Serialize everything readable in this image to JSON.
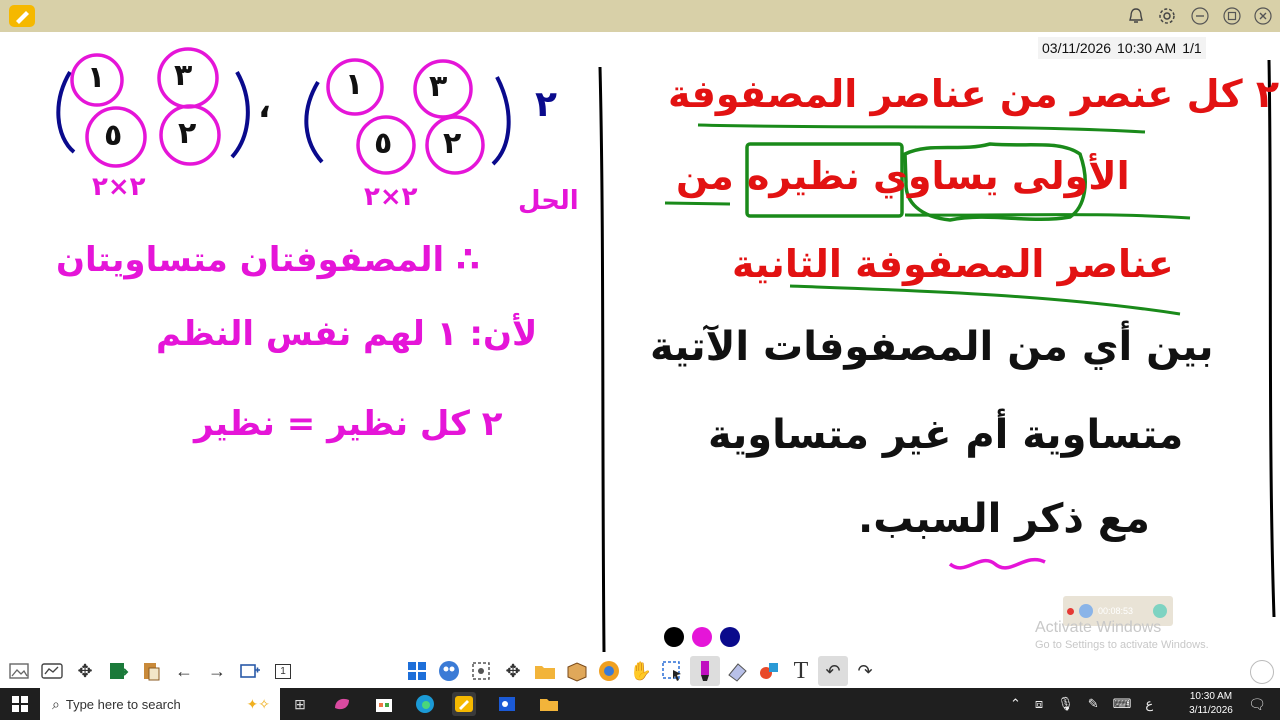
{
  "titlebar": {
    "icons": [
      "pencil-app-icon",
      "bell-icon",
      "settings-icon",
      "minimize-icon",
      "restore-icon",
      "close-icon"
    ]
  },
  "status": {
    "date": "03/11/2026",
    "time": "10:30 AM",
    "page": "1/1"
  },
  "board": {
    "left_panel": {
      "set_label": "٢",
      "matrix_a": [
        "١",
        "٣",
        "٥",
        "٢"
      ],
      "matrix_b": [
        "١",
        "٣",
        "٥",
        "٢"
      ],
      "separator": "،",
      "dims_a": "٢×٢",
      "dims_b": "٢×٢",
      "note": "الحل",
      "line1": "∴ المصفوفتان متساويتان",
      "line2": "لأن: ١ لهم نفس النظم",
      "line3": "٢ كل نظير = نظير"
    },
    "right_panel": {
      "line1": "٢ كل عنصر من عناصر المصفوفة",
      "line2": "الأولى يساوي نظيره من",
      "line3": "عناصر المصفوفة الثانية",
      "line4": "بين أي من المصفوفات الآتية",
      "line5": "متساوية أم غير متساوية",
      "line6": "مع ذكر السبب."
    }
  },
  "recorder": {
    "time": "00:08:53"
  },
  "watermark": {
    "title": "Activate Windows",
    "subtitle": "Go to Settings to activate Windows."
  },
  "colors": {
    "black": "#000000",
    "magenta": "#e515d8",
    "navy": "#0a0a8c",
    "red": "#e21212",
    "green": "#1a8a1a"
  },
  "toolbar": {
    "page_number": "1"
  },
  "taskbar": {
    "search_placeholder": "Type here to search",
    "lang": "ع",
    "clock_time": "10:30 AM",
    "clock_date": "3/11/2026"
  }
}
